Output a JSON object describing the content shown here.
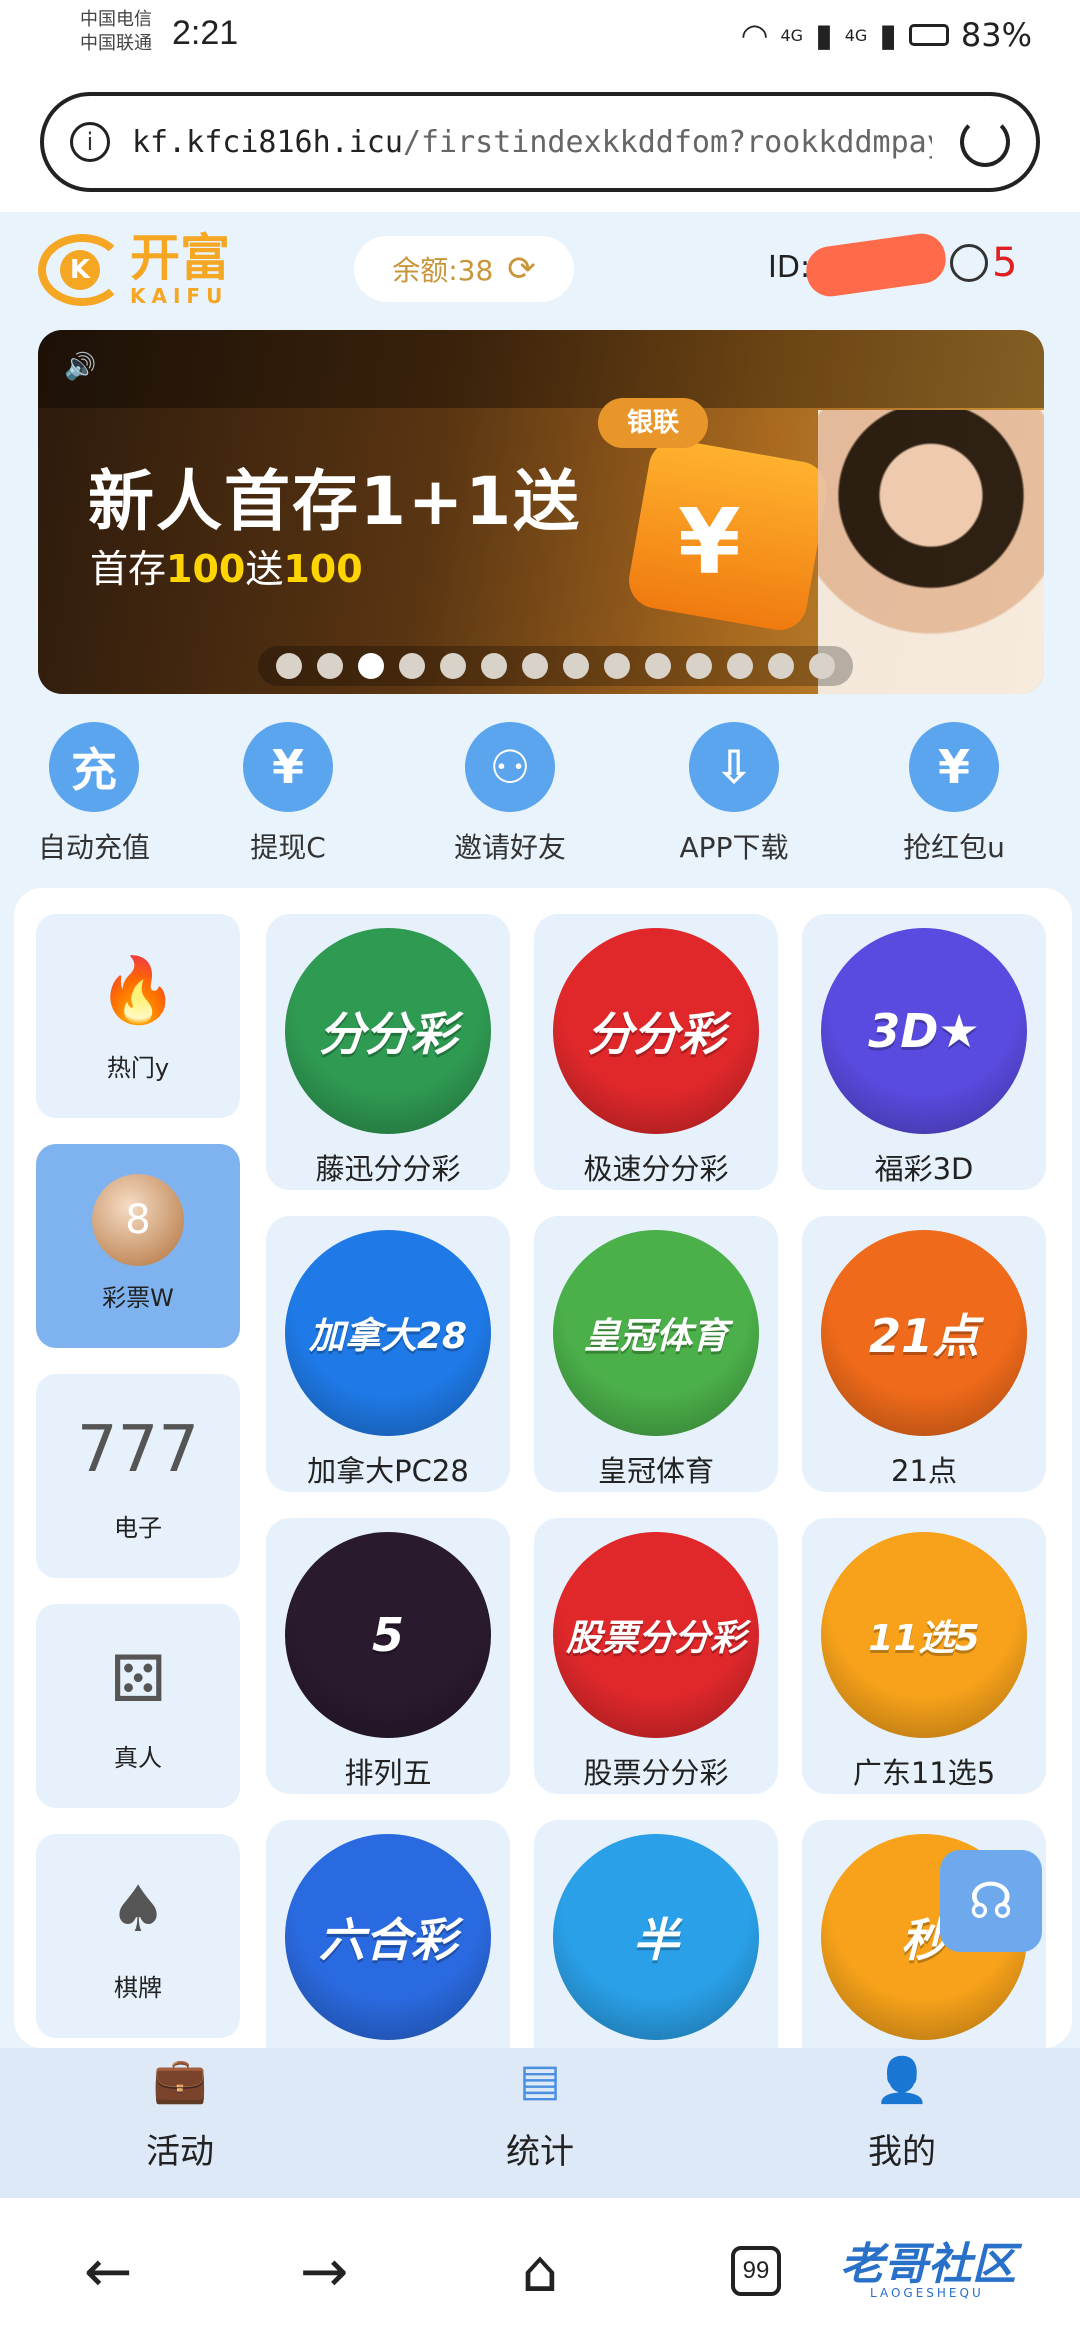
{
  "status_bar": {
    "carrier_1": "中国电信",
    "carrier_2": "中国联通",
    "time": "2:21",
    "network_1": "4G",
    "network_2": "4G",
    "battery": "83%"
  },
  "url_bar": {
    "host": "kf.kfci816h.icu",
    "path": "/firstindexkkddfom?rookkddmpay=qhroo"
  },
  "header": {
    "logo_cn": "开富",
    "logo_en": "KAIFU",
    "logo_mark": "K",
    "balance_label": "余额:38",
    "user_id": "ID:1",
    "message_count": "5"
  },
  "banner": {
    "title": "新人首存1+1送",
    "subtitle_prefix": "首存",
    "subtitle_amount_1": "100",
    "subtitle_mid": "送",
    "subtitle_amount_2": "100",
    "tag": "银联",
    "slide_count": 14,
    "active_slide": 3
  },
  "quick_actions": [
    {
      "label": "自动充值",
      "icon": "recharge-icon",
      "glyph": "充"
    },
    {
      "label": "提现C",
      "icon": "money-bag-icon",
      "glyph": "¥"
    },
    {
      "label": "邀请好友",
      "icon": "invite-friends-icon",
      "glyph": "⚇"
    },
    {
      "label": "APP下载",
      "icon": "cloud-download-icon",
      "glyph": "⇩"
    },
    {
      "label": "抢红包u",
      "icon": "red-envelope-icon",
      "glyph": "¥"
    }
  ],
  "categories": [
    {
      "label": "热门y",
      "icon": "flame-icon",
      "glyph": "🔥",
      "active": false
    },
    {
      "label": "彩票W",
      "icon": "lottery-ball-icon",
      "glyph": "8",
      "active": true
    },
    {
      "label": "电子",
      "icon": "slot-machine-icon",
      "glyph": "777",
      "active": false
    },
    {
      "label": "真人",
      "icon": "dice-icon",
      "glyph": "⚄",
      "active": false
    },
    {
      "label": "棋牌",
      "icon": "playing-cards-icon",
      "glyph": "♠",
      "active": false
    }
  ],
  "games": [
    {
      "label": "藤迅分分彩",
      "art": "分分彩",
      "color": "#2f9a52"
    },
    {
      "label": "极速分分彩",
      "art": "分分彩",
      "color": "#e0282b"
    },
    {
      "label": "福彩3D",
      "art": "3D★",
      "color": "#5a4be0"
    },
    {
      "label": "加拿大PC28",
      "art": "加拿大28",
      "color": "#1f7ae8"
    },
    {
      "label": "皇冠体育",
      "art": "皇冠体育",
      "color": "#4bb04a"
    },
    {
      "label": "21点",
      "art": "21点",
      "color": "#ef6a1a"
    },
    {
      "label": "排列五",
      "art": "5",
      "color": "#2a1a2e"
    },
    {
      "label": "股票分分彩",
      "art": "股票分分彩",
      "color": "#e0282b"
    },
    {
      "label": "广东11选5",
      "art": "11选5",
      "color": "#f7a21a"
    },
    {
      "label": "",
      "art": "六合彩",
      "color": "#2a6ae0"
    },
    {
      "label": "",
      "art": "半",
      "color": "#2aa0e8"
    },
    {
      "label": "",
      "art": "秒",
      "color": "#f7a21a"
    }
  ],
  "bottom_tabs": [
    {
      "label": "活动",
      "icon": "briefcase-icon",
      "glyph": "💼"
    },
    {
      "label": "统计",
      "icon": "document-icon",
      "glyph": "▤"
    },
    {
      "label": "我的",
      "icon": "user-icon",
      "glyph": "👤"
    }
  ],
  "browser_nav": {
    "tab_count": "99",
    "watermark": "老哥社区",
    "watermark_en": "LAOGESHEQU"
  }
}
